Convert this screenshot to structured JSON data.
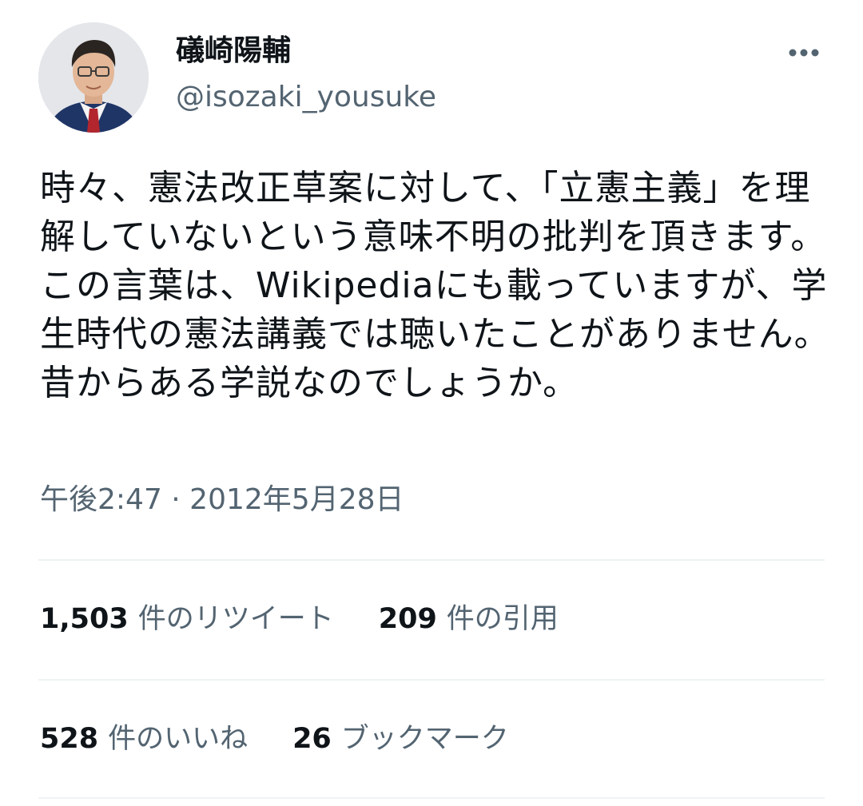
{
  "user": {
    "display_name": "礒崎陽輔",
    "handle": "@isozaki_yousuke"
  },
  "more_icon": "more-horizontal-icon",
  "tweet": {
    "text": "時々、憲法改正草案に対して、「立憲主義」を理解していないという意味不明の批判を頂きます。この言葉は、Wikipediaにも載っていますが、学生時代の憲法講義では聴いたことがありません。昔からある学説なのでしょうか。",
    "timestamp": "午後2:47 · 2012年5月28日"
  },
  "stats": {
    "retweets": {
      "count": "1,503",
      "label": "件のリツイート"
    },
    "quotes": {
      "count": "209",
      "label": "件の引用"
    },
    "likes": {
      "count": "528",
      "label": "件のいいね"
    },
    "bookmarks": {
      "count": "26",
      "label": "ブックマーク"
    }
  },
  "colors": {
    "text_primary": "#0f1419",
    "text_secondary": "#536471",
    "divider": "#eff3f4"
  }
}
